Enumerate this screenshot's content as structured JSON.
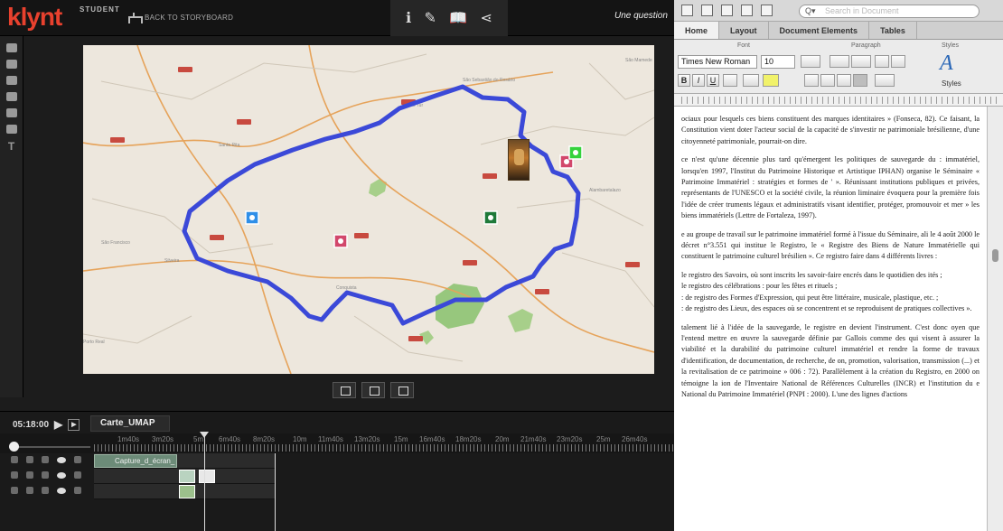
{
  "klynt": {
    "logo": "klynt",
    "logo_badge": "STUDENT",
    "back_label": "BACK TO STORYBOARD",
    "tools": {
      "info": "ℹ",
      "edit": "✎",
      "book": "📖",
      "share": "⋖"
    },
    "title_text": "Une question",
    "timeline": {
      "timecode": "05:18:00",
      "sequence_tab": "Carte_UMAP",
      "ruler_labels": [
        "1m40s",
        "3m20s",
        "5m",
        "6m40s",
        "8m20s",
        "10m",
        "11m40s",
        "13m20s",
        "15m",
        "16m40s",
        "18m20s",
        "20m",
        "21m40s",
        "23m20s",
        "25m",
        "26m40s"
      ],
      "clips": [
        {
          "label": "Capture_d_écran_"
        }
      ]
    }
  },
  "word": {
    "search_placeholder": "Search in Document",
    "tabs": [
      "Home",
      "Layout",
      "Document Elements",
      "Tables"
    ],
    "ribbon": {
      "font_group": "Font",
      "paragraph_group": "Paragraph",
      "styles_group": "Styles",
      "font_name": "Times New Roman",
      "font_size": "10",
      "bold": "B",
      "italic": "I",
      "underline": "U",
      "styles_label": "Styles"
    },
    "paragraphs": [
      "ociaux pour lesquels ces biens constituent des marques identitaires » (Fonseca, 82). Ce faisant, la Constitution vient doter l'acteur social de la capacité de s'investir ne patrimoniale brésilienne, d'une citoyenneté patrimoniale, pourrait-on dire.",
      "ce n'est qu'une décennie plus tard qu'émergent les politiques de sauvegarde du : immatériel, lorsqu'en 1997, l'Institut du Patrimoine Historique et Artistique IPHAN) organise le Séminaire « Patrimoine Immatériel : stratégies et formes de ' ». Réunissant institutions publiques et privées, représentants de l'UNESCO et la société civile, la réunion liminaire évoquera pour la première fois l'idée de créer truments légaux et administratifs visant identifier, protéger, promouvoir et mer » les biens immatériels (Lettre de Fortaleza, 1997).",
      "e au groupe de travail sur le patrimoine immatériel formé à l'issue du Séminaire, ali le 4 août 2000 le décret n°3.551 qui institue le Registro, le « Registre des Biens de Nature Immatérielle qui constituent le patrimoine culturel brésilien ». Ce registro faire dans 4 différents livres :",
      "le registro des Savoirs, où sont inscrits les savoir-faire encrés dans le quotidien des ités ;",
      "le registro des célébrations : pour les fêtes et rituels ;",
      ": de registro des Formes d'Expression, qui peut être littéraire, musicale, plastique, etc. ;",
      ": de registro des Lieux, des espaces où se concentrent et se reproduisent de pratiques collectives ».",
      "talement lié à l'idée de la sauvegarde, le registre en devient l'instrument. C'est donc oyen que l'entend mettre en œuvre la sauvegarde définie par Gallois comme des qui visent à assurer la viabilité et la durabilité du patrimoine culturel immatériel et rendre la forme de travaux d'identification, de documentation, de recherche, de on, promotion, valorisation, transmission (...) et la revitalisation de ce patrimoine » 006 : 72). Parallèlement à la création du Registro, en 2000 on témoigne la ion de l'Inventaire National de Références Culturelles (INCR) et l'institution du e National du Patrimoine Immatériel (PNPI : 2000). L'une des lignes d'actions"
    ]
  },
  "colors": {
    "route": "#3b49d8",
    "klynt_red": "#e8412e",
    "marker_blue": "#2f8fe8",
    "marker_pink": "#d2476b",
    "marker_green": "#1f7a3a",
    "marker_lime": "#35d23c"
  }
}
